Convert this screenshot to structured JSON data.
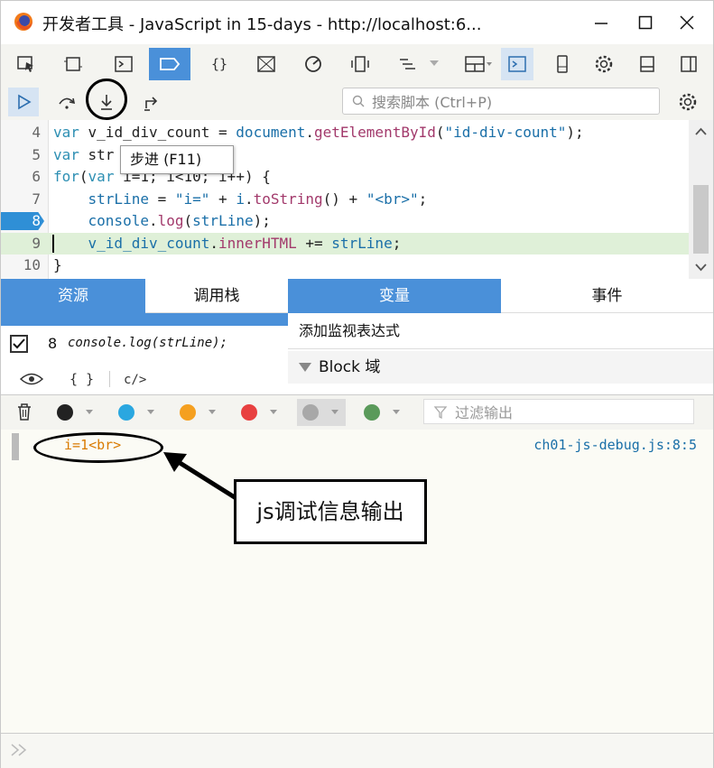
{
  "window": {
    "title": "开发者工具 - JavaScript in 15-days - http://localhost:6..."
  },
  "debugger": {
    "search_placeholder": "搜索脚本 (Ctrl+P)",
    "tooltip": "步进 (F11)"
  },
  "code": {
    "lines": [
      {
        "num": "4",
        "parts": [
          [
            "kw",
            "var"
          ],
          [
            "var",
            " v_id_div_count = "
          ],
          [
            "str",
            "document"
          ],
          [
            "var",
            "."
          ],
          [
            "fn",
            "getElementById"
          ],
          [
            "var",
            "("
          ],
          [
            "str",
            "\"id-div-count\""
          ],
          [
            "var",
            ");"
          ]
        ]
      },
      {
        "num": "5",
        "parts": [
          [
            "kw",
            "var"
          ],
          [
            "var",
            " str"
          ]
        ]
      },
      {
        "num": "6",
        "parts": [
          [
            "kw",
            "for"
          ],
          [
            "var",
            "("
          ],
          [
            "kw",
            "var"
          ],
          [
            "var",
            " i=1; i<10; i++) {"
          ]
        ]
      },
      {
        "num": "7",
        "parts": [
          [
            "var",
            "    "
          ],
          [
            "str",
            "strLine"
          ],
          [
            "var",
            " = "
          ],
          [
            "str",
            "\"i=\""
          ],
          [
            "var",
            " + "
          ],
          [
            "str",
            "i"
          ],
          [
            "var",
            "."
          ],
          [
            "fn",
            "toString"
          ],
          [
            "var",
            "() + "
          ],
          [
            "str",
            "\"<br>\""
          ],
          [
            "var",
            ";"
          ]
        ]
      },
      {
        "num": "8",
        "parts": [
          [
            "var",
            "    "
          ],
          [
            "str",
            "console"
          ],
          [
            "var",
            "."
          ],
          [
            "fn",
            "log"
          ],
          [
            "var",
            "("
          ],
          [
            "str",
            "strLine"
          ],
          [
            "var",
            ");"
          ]
        ]
      },
      {
        "num": "9",
        "parts": [
          [
            "var",
            "    "
          ],
          [
            "str",
            "v_id_div_count"
          ],
          [
            "var",
            "."
          ],
          [
            "fn",
            "innerHTML"
          ],
          [
            "var",
            " += "
          ],
          [
            "str",
            "strLine"
          ],
          [
            "var",
            ";"
          ]
        ]
      },
      {
        "num": "10",
        "parts": [
          [
            "var",
            "}"
          ]
        ]
      }
    ],
    "breakpoint_line": "8",
    "current_line": "9"
  },
  "tabs": {
    "sources": "资源",
    "callstack": "调用栈",
    "variables": "变量",
    "events": "事件"
  },
  "breakpoints": {
    "line": "8",
    "code": "console.log(strLine);"
  },
  "variables_panel": {
    "add_watch": "添加监视表达式",
    "block_scope": "Block 域"
  },
  "console": {
    "filter_placeholder": "过滤输出",
    "dot_colors": [
      "#222222",
      "#2aa7e0",
      "#f5a020",
      "#e84040",
      "#a8a8a8",
      "#5a9a5a"
    ],
    "log_message": "i=1<br>",
    "log_source": "ch01-js-debug.js:8:5"
  },
  "annotation": {
    "callout": "js调试信息输出"
  },
  "colors": {
    "accent": "#4a90d9",
    "breakpoint": "#2f8fd6",
    "current_line_bg": "#dff0d8"
  }
}
